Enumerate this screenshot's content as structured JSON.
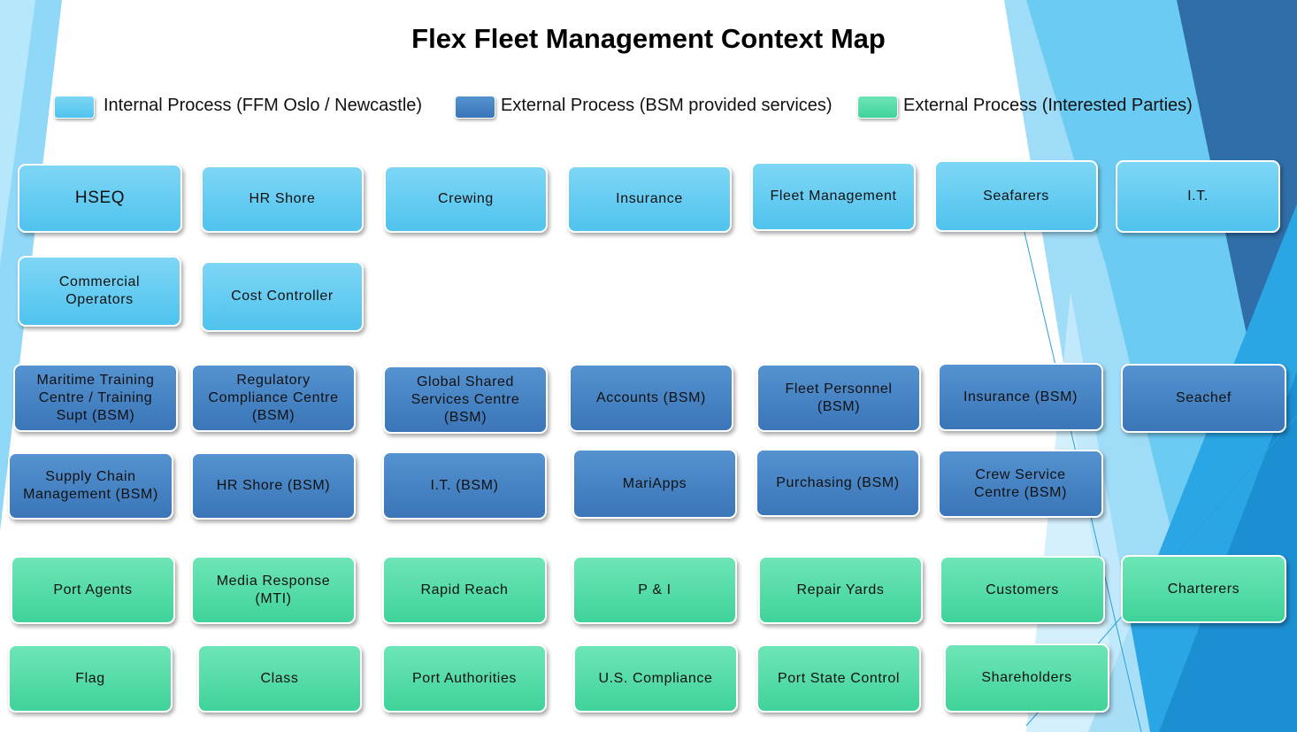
{
  "title": "Flex Fleet Management Context Map",
  "colors": {
    "internal": "#5ccaf1",
    "bsm": "#3f7bbd",
    "party": "#49d8a2",
    "background_accent": "#1e88d4"
  },
  "legend": [
    {
      "label": "Internal Process (FFM Oslo / Newcastle)",
      "color": "#5ccaf1"
    },
    {
      "label": "External Process (BSM provided services)",
      "color": "#3f7bbd"
    },
    {
      "label": "External Process (Interested Parties)",
      "color": "#49d8a2"
    }
  ],
  "internal": [
    "HSEQ",
    "HR Shore",
    "Crewing",
    "Insurance",
    "Fleet Management",
    "Seafarers",
    "I.T.",
    "Commercial\nOperators",
    "Cost Controller"
  ],
  "bsm": [
    "Maritime Training\nCentre / Training\nSupt (BSM)",
    "Regulatory\nCompliance Centre\n(BSM)",
    "Global Shared\nServices Centre\n(BSM)",
    "Accounts (BSM)",
    "Fleet Personnel\n(BSM)",
    "Insurance (BSM)",
    "Seachef",
    "Supply Chain\nManagement (BSM)",
    "HR Shore (BSM)",
    "I.T. (BSM)",
    "MariApps",
    "Purchasing (BSM)",
    "Crew Service\nCentre (BSM)"
  ],
  "parties": [
    "Port Agents",
    "Media Response\n(MTI)",
    "Rapid Reach",
    "P & I",
    "Repair Yards",
    "Customers",
    "Charterers",
    "Flag",
    "Class",
    "Port Authorities",
    "U.S. Compliance",
    "Port State Control",
    "Shareholders"
  ]
}
